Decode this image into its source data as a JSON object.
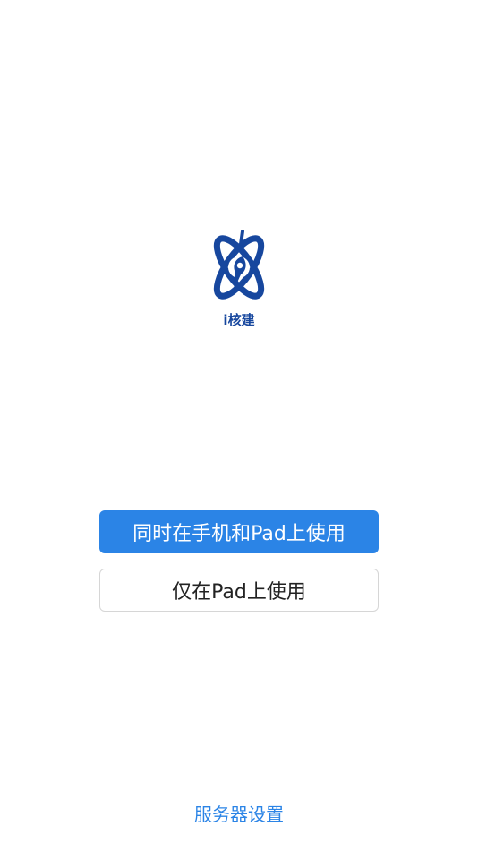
{
  "logo": {
    "icon": "atom-logo-icon",
    "text": "i核建",
    "color": "#17479e"
  },
  "actions": {
    "primary_label": "同时在手机和Pad上使用",
    "secondary_label": "仅在Pad上使用",
    "accent_color": "#2b84e6"
  },
  "footer": {
    "server_settings_label": "服务器设置"
  }
}
